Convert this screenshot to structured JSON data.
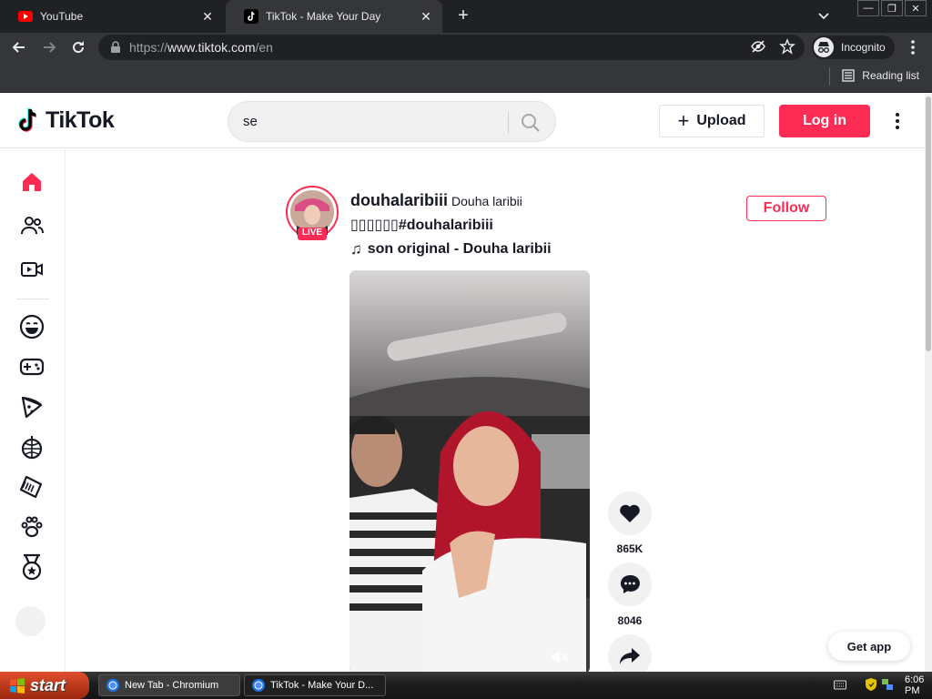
{
  "browser": {
    "tabs": [
      {
        "title": "YouTube",
        "active": false
      },
      {
        "title": "TikTok - Make Your Day",
        "active": true
      }
    ],
    "url_prefix": "https://",
    "url_domain": "www.tiktok.com",
    "url_path": "/en",
    "incognito_label": "Incognito",
    "reading_list_label": "Reading list"
  },
  "tiktok": {
    "logo_text": "TikTok",
    "search_value": "se",
    "upload_label": "Upload",
    "login_label": "Log in",
    "post": {
      "username": "douhalaribiii",
      "nickname": "Douha laribii",
      "live_badge": "LIVE",
      "description": "▯▯▯▯▯▯#douhalaribiii",
      "music": "son original - Douha laribii",
      "follow_label": "Follow",
      "likes": "865K",
      "comments": "8046"
    },
    "get_app_label": "Get app"
  },
  "taskbar": {
    "start_label": "start",
    "tasks": [
      "New Tab - Chromium",
      "TikTok - Make Your D..."
    ],
    "clock": "6:06 PM"
  },
  "colors": {
    "brand_red": "#fe2c55",
    "text_dark": "#161823",
    "chrome_dark": "#202124",
    "chrome_mid": "#35363a"
  }
}
